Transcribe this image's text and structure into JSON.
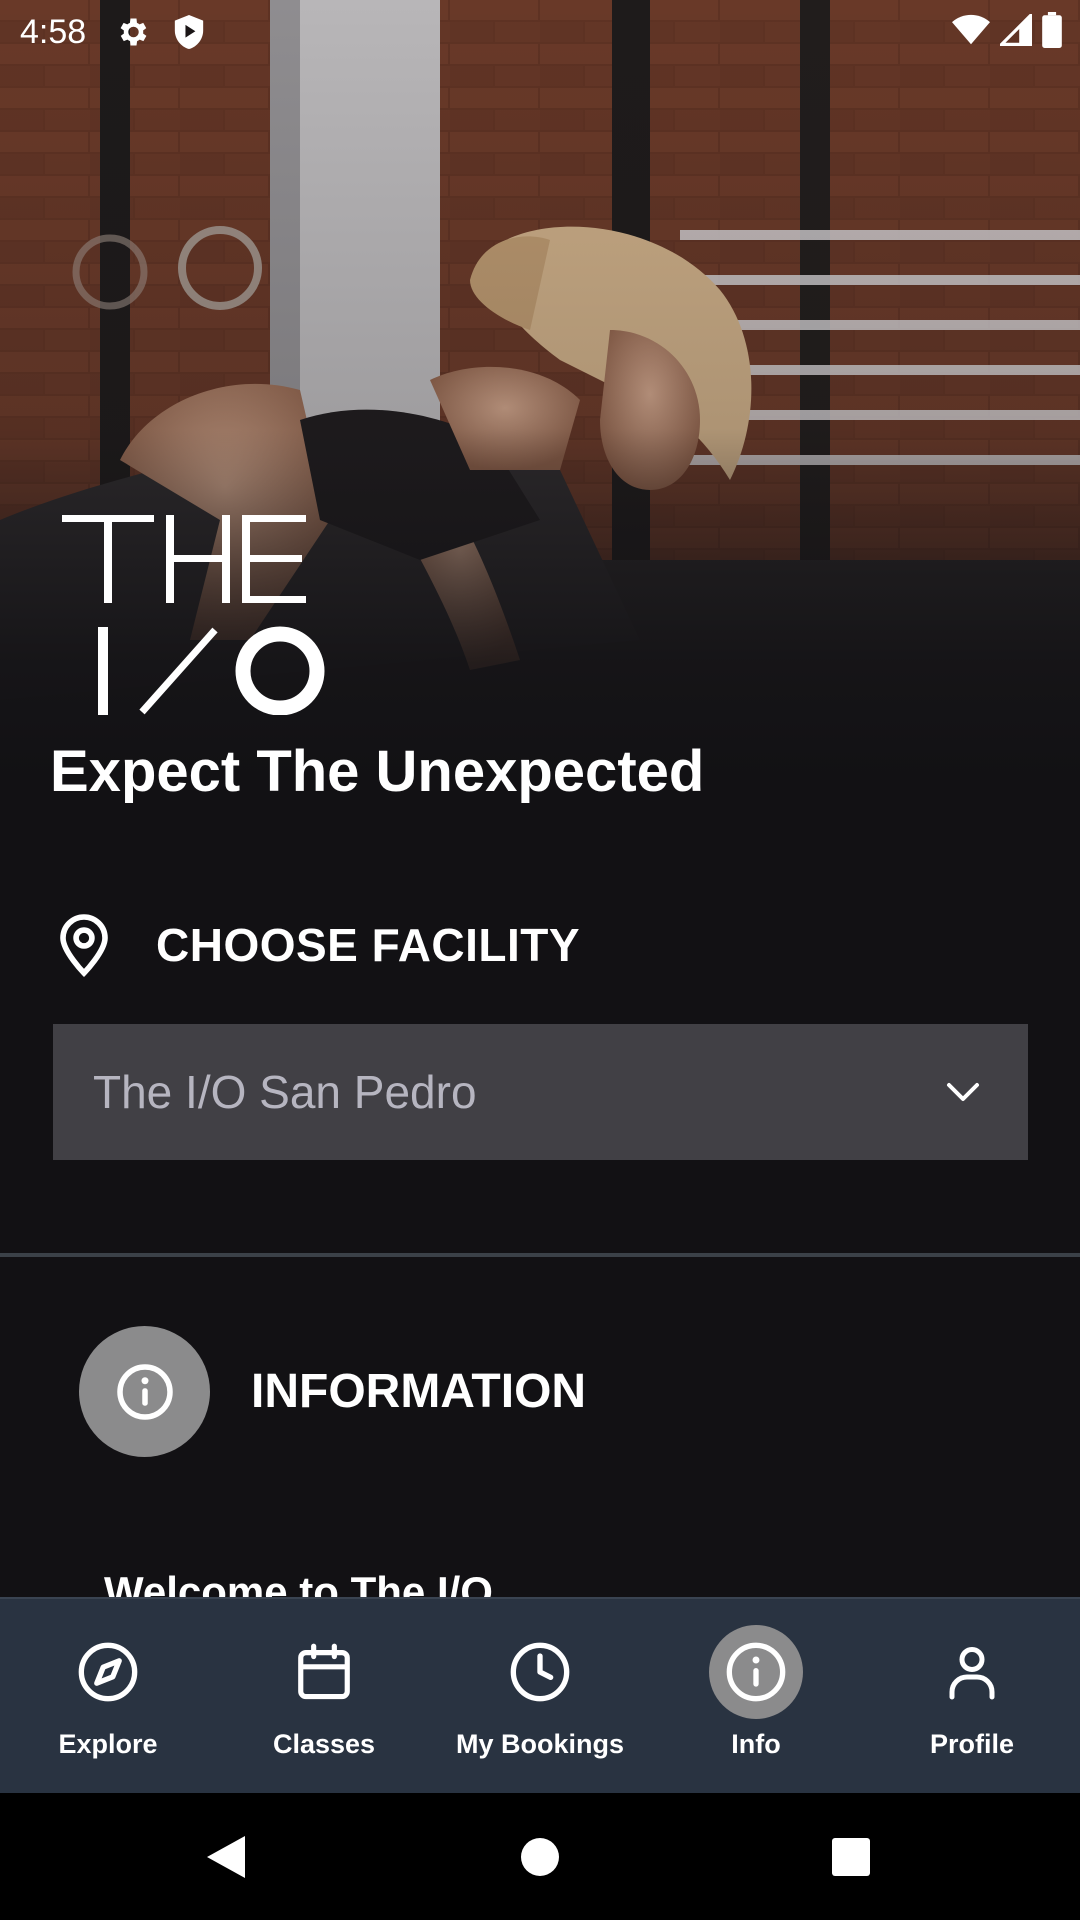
{
  "status_bar": {
    "time": "4:58",
    "icons": [
      "settings-gear-icon",
      "play-protect-shield-icon",
      "wifi-icon",
      "signal-icon",
      "battery-icon"
    ]
  },
  "hero": {
    "logo_line1": "THE",
    "logo_line2": "I/O",
    "tagline": "Expect The Unexpected"
  },
  "facility": {
    "title": "CHOOSE FACILITY",
    "selected": "The I/O San Pedro",
    "icon": "map-pin-icon"
  },
  "information": {
    "title": "INFORMATION",
    "welcome": "Welcome to The I/O"
  },
  "bottom_nav": {
    "items": [
      {
        "label": "Explore",
        "icon": "compass-icon",
        "active": false
      },
      {
        "label": "Classes",
        "icon": "calendar-icon",
        "active": false
      },
      {
        "label": "My Bookings",
        "icon": "clock-icon",
        "active": false
      },
      {
        "label": "Info",
        "icon": "info-icon",
        "active": true
      },
      {
        "label": "Profile",
        "icon": "person-icon",
        "active": false
      }
    ]
  },
  "colors": {
    "background": "#121114",
    "select_bg": "#414045",
    "select_text": "#b6b5c0",
    "nav_bg": "#293341",
    "active_circle": "#8b8b8c"
  }
}
